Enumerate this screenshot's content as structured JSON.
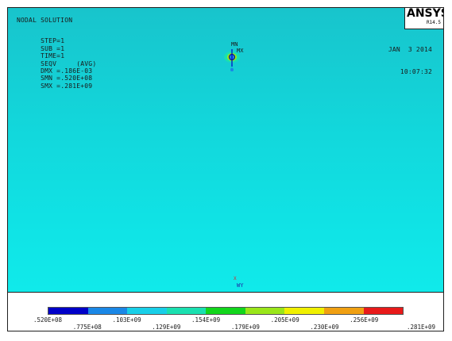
{
  "header": {
    "title": "NODAL SOLUTION",
    "stats": [
      "STEP=1",
      "SUB =1",
      "TIME=1",
      "SEQV     (AVG)",
      "DMX =.186E-03",
      "SMN =.520E+08",
      "SMX =.281E+09"
    ]
  },
  "datetime": {
    "date": "JAN  3 2014",
    "time": "10:07:32"
  },
  "logo": {
    "name": "ANSYS",
    "version": "R14.5"
  },
  "markers": {
    "min": "MN",
    "max": "MX"
  },
  "triad": {
    "x": "X",
    "y": "WY"
  },
  "legend": {
    "colors": [
      "#0000c8",
      "#1a87e6",
      "#18cfe8",
      "#1ae0b0",
      "#12d61c",
      "#9ae61a",
      "#f0f000",
      "#f0a012",
      "#e81a1a"
    ],
    "labels_top": [
      ".520E+08",
      ".103E+09",
      ".154E+09",
      ".205E+09",
      ".256E+09"
    ],
    "labels_bottom": [
      ".775E+08",
      ".129E+09",
      ".179E+09",
      ".230E+09",
      ".281E+09"
    ]
  },
  "accent": {
    "background_top": "#18c4cc",
    "background_bottom": "#10eaea"
  }
}
